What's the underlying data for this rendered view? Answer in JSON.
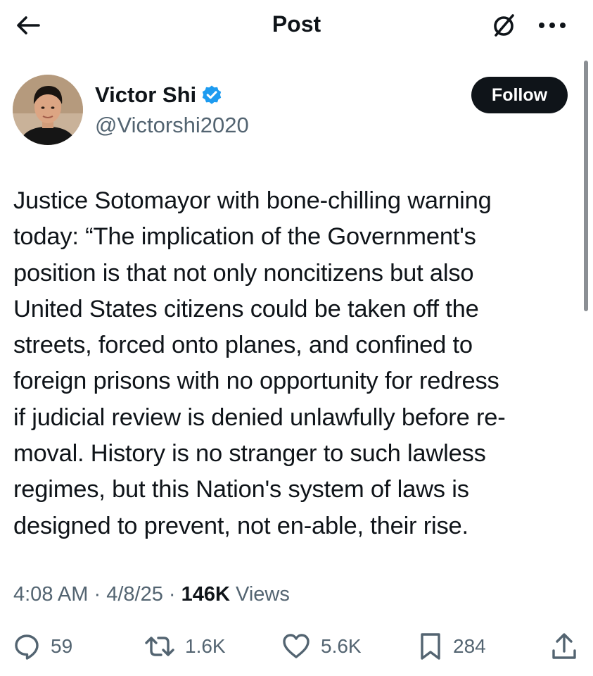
{
  "nav": {
    "title": "Post",
    "back_icon": "arrow-left-icon",
    "grok_icon": "grok-icon",
    "more_icon": "more-horizontal-icon"
  },
  "author": {
    "name": "Victor Shi",
    "handle": "@Victorshi2020",
    "verified": true,
    "verified_color": "#1d9bf0",
    "follow_label": "Follow"
  },
  "tweet": {
    "lines": [
      "Justice Sotomayor with bone-chilling warning",
      "today: “The implication of the Government's",
      "position is that not only noncitizens but also",
      "United States citizens could be taken off the",
      "streets, forced onto planes, and confined to",
      "foreign prisons with no opportunity for redress",
      "if judicial review is denied unlawfully before re-",
      "moval. History is no stranger to such lawless",
      "regimes, but this Nation's system of laws is",
      "designed to prevent, not en-able, their rise."
    ]
  },
  "meta": {
    "time": "4:08 AM",
    "separator": "·",
    "date": "4/8/25",
    "views_count": "146K",
    "views_label": "Views"
  },
  "actions": {
    "reply_count": "59",
    "retweet_count": "1.6K",
    "like_count": "5.6K",
    "bookmark_count": "284"
  }
}
